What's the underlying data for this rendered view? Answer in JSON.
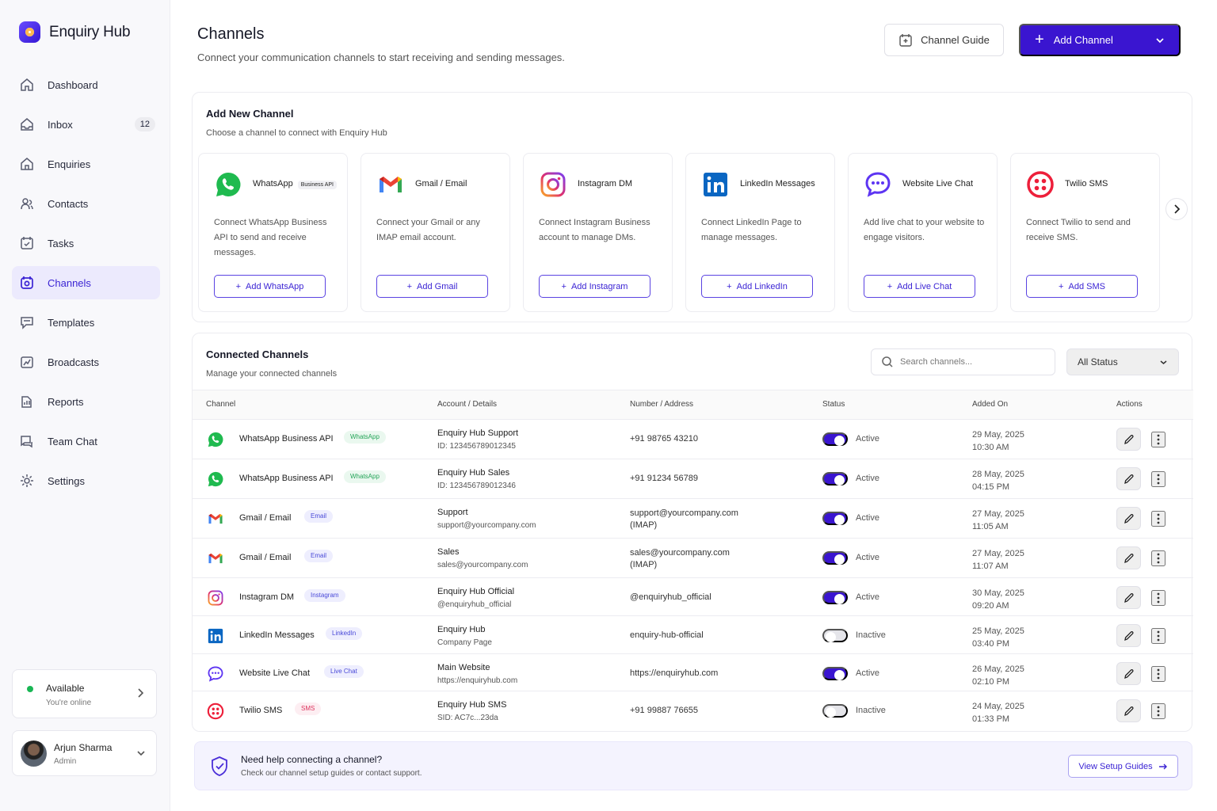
{
  "app": {
    "name": "Enquiry Hub"
  },
  "sidebar": {
    "items": [
      {
        "label": "Dashboard",
        "icon": "home-icon",
        "active": false
      },
      {
        "label": "Inbox",
        "icon": "inbox-icon",
        "active": false,
        "badge": "12"
      },
      {
        "label": "Enquiries",
        "icon": "enquiries-icon",
        "active": false
      },
      {
        "label": "Contacts",
        "icon": "contacts-icon",
        "active": false
      },
      {
        "label": "Tasks",
        "icon": "tasks-icon",
        "active": false
      },
      {
        "label": "Channels",
        "icon": "channels-icon",
        "active": true
      },
      {
        "label": "Templates",
        "icon": "templates-icon",
        "active": false
      },
      {
        "label": "Broadcasts",
        "icon": "broadcasts-icon",
        "active": false
      },
      {
        "label": "Reports",
        "icon": "reports-icon",
        "active": false
      },
      {
        "label": "Team Chat",
        "icon": "team-chat-icon",
        "active": false
      },
      {
        "label": "Settings",
        "icon": "settings-icon",
        "active": false
      }
    ],
    "presence": {
      "title": "Available",
      "subtitle": "You're online"
    },
    "profile": {
      "name": "Arjun Sharma",
      "role": "Admin"
    }
  },
  "header": {
    "title": "Channels",
    "subtitle": "Connect your communication channels to start receiving and sending messages.",
    "guide_label": "Channel Guide",
    "add_label": "Add Channel"
  },
  "add_channel": {
    "title": "Add New Channel",
    "subtitle": "Choose a channel to connect with Enquiry Hub",
    "cards": [
      {
        "name": "WhatsApp",
        "badge": "Business API",
        "description": "Connect WhatsApp Business API to send and receive messages.",
        "button": "Add WhatsApp",
        "icon": "whatsapp-icon"
      },
      {
        "name": "Gmail / Email",
        "description": "Connect your Gmail or any IMAP email account.",
        "button": "Add Gmail",
        "icon": "gmail-icon"
      },
      {
        "name": "Instagram DM",
        "description": "Connect Instagram Business account to manage DMs.",
        "button": "Add Instagram",
        "icon": "instagram-icon"
      },
      {
        "name": "LinkedIn Messages",
        "description": "Connect LinkedIn Page to manage messages.",
        "button": "Add LinkedIn",
        "icon": "linkedin-icon"
      },
      {
        "name": "Website Live Chat",
        "description": "Add live chat to your website to engage visitors.",
        "button": "Add Live Chat",
        "icon": "live-chat-icon"
      },
      {
        "name": "Twilio SMS",
        "description": "Connect Twilio to send and receive SMS.",
        "button": "Add SMS",
        "icon": "twilio-icon"
      }
    ]
  },
  "connected": {
    "title": "Connected Channels",
    "subtitle": "Manage your connected channels",
    "search_placeholder": "Search channels...",
    "status_filter": "All Status",
    "columns": [
      "Channel",
      "Account / Details",
      "Number / Address",
      "Status",
      "Added On",
      "Actions"
    ],
    "rows": [
      {
        "channel": "WhatsApp Business API",
        "tag": "WhatsApp",
        "tag_color": "green",
        "icon": "whatsapp-icon",
        "account": "Enquiry Hub Support",
        "account_sub": "ID: 123456789012345",
        "number": "+91 98765 43210",
        "number_sub": "",
        "active": true,
        "status": "Active",
        "date": "29 May, 2025",
        "time": "10:30 AM"
      },
      {
        "channel": "WhatsApp Business API",
        "tag": "WhatsApp",
        "tag_color": "green",
        "icon": "whatsapp-icon",
        "account": "Enquiry Hub Sales",
        "account_sub": "ID: 123456789012346",
        "number": "+91 91234 56789",
        "number_sub": "",
        "active": true,
        "status": "Active",
        "date": "28 May, 2025",
        "time": "04:15 PM"
      },
      {
        "channel": "Gmail / Email",
        "tag": "Email",
        "tag_color": "blue",
        "icon": "gmail-icon",
        "account": "Support",
        "account_sub": "support@yourcompany.com",
        "number": "support@yourcompany.com",
        "number_sub": "(IMAP)",
        "active": true,
        "status": "Active",
        "date": "27 May, 2025",
        "time": "11:05 AM"
      },
      {
        "channel": "Gmail / Email",
        "tag": "Email",
        "tag_color": "blue",
        "icon": "gmail-icon",
        "account": "Sales",
        "account_sub": "sales@yourcompany.com",
        "number": "sales@yourcompany.com",
        "number_sub": "(IMAP)",
        "active": true,
        "status": "Active",
        "date": "27 May, 2025",
        "time": "11:07 AM"
      },
      {
        "channel": "Instagram DM",
        "tag": "Instagram",
        "tag_color": "blue",
        "icon": "instagram-icon",
        "account": "Enquiry Hub Official",
        "account_sub": "@enquiryhub_official",
        "number": "@enquiryhub_official",
        "number_sub": "",
        "active": true,
        "status": "Active",
        "date": "30 May, 2025",
        "time": "09:20 AM"
      },
      {
        "channel": "LinkedIn Messages",
        "tag": "LinkedIn",
        "tag_color": "blue",
        "icon": "linkedin-icon",
        "account": "Enquiry Hub",
        "account_sub": "Company Page",
        "number": "enquiry-hub-official",
        "number_sub": "",
        "active": false,
        "status": "Inactive",
        "date": "25 May, 2025",
        "time": "03:40 PM"
      },
      {
        "channel": "Website Live Chat",
        "tag": "Live Chat",
        "tag_color": "blue",
        "icon": "live-chat-icon",
        "account": "Main Website",
        "account_sub": "https://enquiryhub.com",
        "number": "https://enquiryhub.com",
        "number_sub": "",
        "active": true,
        "status": "Active",
        "date": "26 May, 2025",
        "time": "02:10 PM"
      },
      {
        "channel": "Twilio SMS",
        "tag": "SMS",
        "tag_color": "pink",
        "icon": "twilio-icon",
        "account": "Enquiry Hub SMS",
        "account_sub": "SID: AC7c...23da",
        "number": "+91 99887 76655",
        "number_sub": "",
        "active": false,
        "status": "Inactive",
        "date": "24 May, 2025",
        "time": "01:33 PM"
      }
    ]
  },
  "help": {
    "title": "Need help connecting a channel?",
    "subtitle": "Check our channel setup guides or contact support.",
    "button": "View Setup Guides"
  }
}
